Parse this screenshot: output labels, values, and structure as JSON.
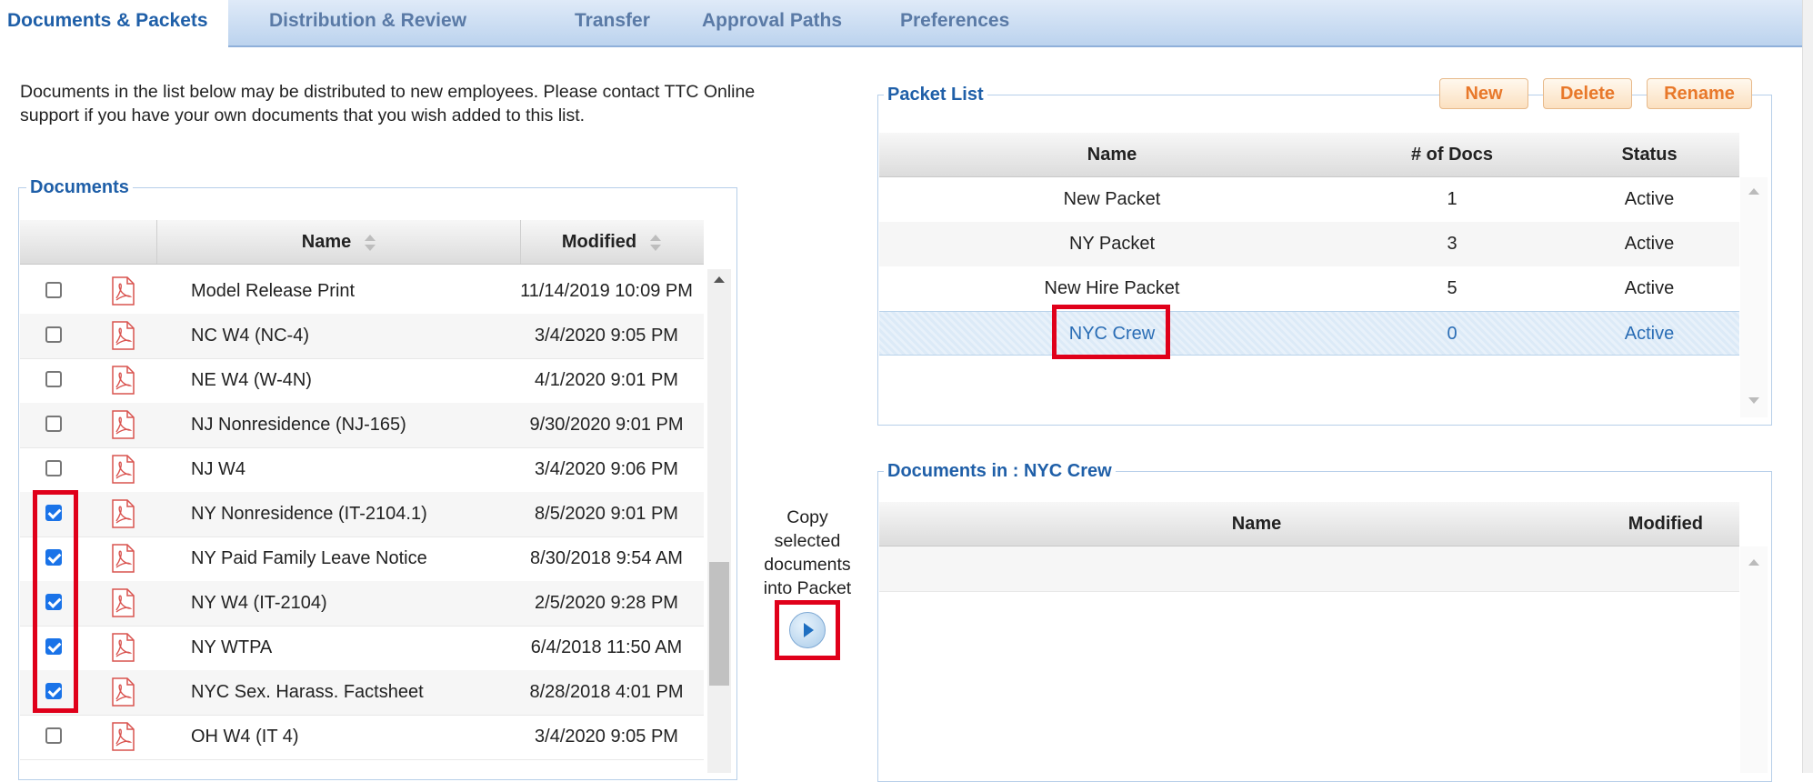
{
  "tabs": [
    {
      "label": "Documents & Packets",
      "active": true
    },
    {
      "label": "Distribution & Review"
    },
    {
      "label": "Transfer"
    },
    {
      "label": "Approval Paths"
    },
    {
      "label": "Preferences"
    }
  ],
  "intro_text": "Documents in the list below may be distributed to new employees. Please contact TTC Online support if you have your own documents that you wish added to this list.",
  "documents": {
    "legend": "Documents",
    "col_name": "Name",
    "col_modified": "Modified",
    "rows": [
      {
        "checked": false,
        "name": "Model Release Print",
        "modified": "11/14/2019 10:09 PM"
      },
      {
        "checked": false,
        "name": "NC W4 (NC-4)",
        "modified": "3/4/2020 9:05 PM"
      },
      {
        "checked": false,
        "name": "NE W4 (W-4N)",
        "modified": "4/1/2020 9:01 PM"
      },
      {
        "checked": false,
        "name": "NJ Nonresidence (NJ-165)",
        "modified": "9/30/2020 9:01 PM"
      },
      {
        "checked": false,
        "name": "NJ W4",
        "modified": "3/4/2020 9:06 PM"
      },
      {
        "checked": true,
        "name": "NY Nonresidence (IT-2104.1)",
        "modified": "8/5/2020 9:01 PM"
      },
      {
        "checked": true,
        "name": "NY Paid Family Leave Notice",
        "modified": "8/30/2018 9:54 AM"
      },
      {
        "checked": true,
        "name": "NY W4 (IT-2104)",
        "modified": "2/5/2020 9:28 PM"
      },
      {
        "checked": true,
        "name": "NY WTPA",
        "modified": "6/4/2018 11:50 AM"
      },
      {
        "checked": true,
        "name": "NYC Sex. Harass. Factsheet",
        "modified": "8/28/2018 4:01 PM"
      },
      {
        "checked": false,
        "name": "OH W4 (IT 4)",
        "modified": "3/4/2020 9:05 PM"
      }
    ]
  },
  "copy": {
    "label": "Copy selected documents into Packet"
  },
  "packets": {
    "legend": "Packet List",
    "btn_new": "New",
    "btn_delete": "Delete",
    "btn_rename": "Rename",
    "col_name": "Name",
    "col_docs": "# of Docs",
    "col_status": "Status",
    "rows": [
      {
        "name": "New Packet",
        "docs": "1",
        "status": "Active"
      },
      {
        "name": "NY Packet",
        "docs": "3",
        "status": "Active"
      },
      {
        "name": "New Hire Packet",
        "docs": "5",
        "status": "Active"
      },
      {
        "name": "NYC Crew",
        "docs": "0",
        "status": "Active",
        "selected": true
      }
    ]
  },
  "packet_docs": {
    "legend": "Documents in : NYC Crew",
    "col_name": "Name",
    "col_modified": "Modified"
  },
  "colors": {
    "accent": "#1f5fa8",
    "highlight": "#e0001a",
    "button_text": "#e8782a",
    "checkbox": "#1a73e8"
  }
}
